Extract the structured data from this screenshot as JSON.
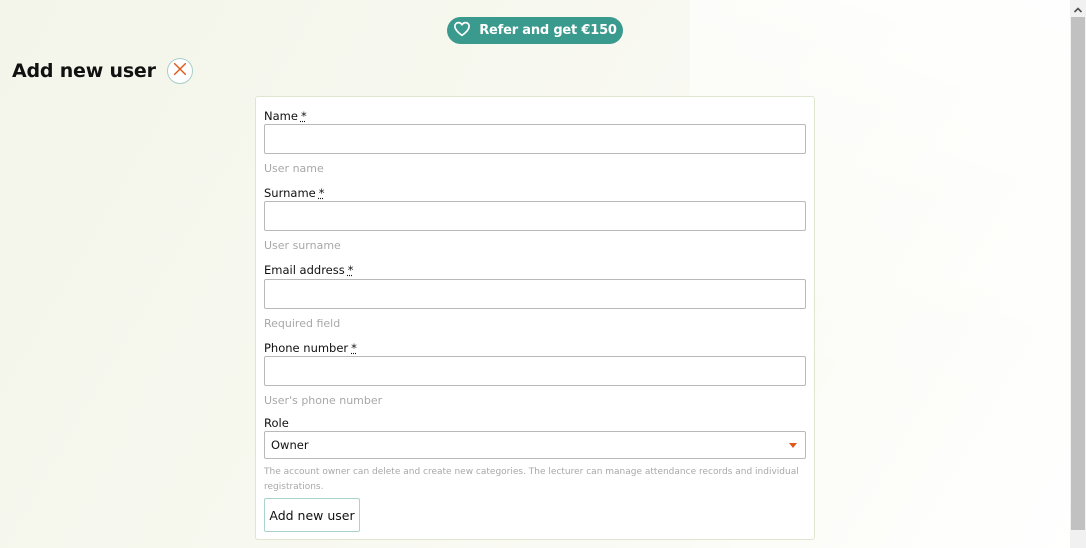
{
  "header": {
    "refer_label": "Refer and get €150",
    "title": "Add new user"
  },
  "form": {
    "required_marker": "*",
    "name": {
      "label": "Name",
      "value": "",
      "help": "User name"
    },
    "surname": {
      "label": "Surname",
      "value": "",
      "help": "User surname"
    },
    "email": {
      "label": "Email address",
      "value": "",
      "help": "Required field"
    },
    "phone": {
      "label": "Phone number",
      "value": "",
      "help": "User's phone number"
    },
    "role": {
      "label": "Role",
      "selected": "Owner",
      "help": "The account owner can delete and create new categories. The lecturer can manage attendance records and individual registrations."
    },
    "submit_label": "Add new user"
  },
  "colors": {
    "accent": "#3a9a8e",
    "close_x": "#e0591c",
    "caret": "#e0591c",
    "help_text": "#a8a8a8"
  },
  "icons": {
    "refer": "heart-icon",
    "close": "close-icon",
    "select": "caret-down-icon",
    "scroll": "chevron-up-icon"
  }
}
